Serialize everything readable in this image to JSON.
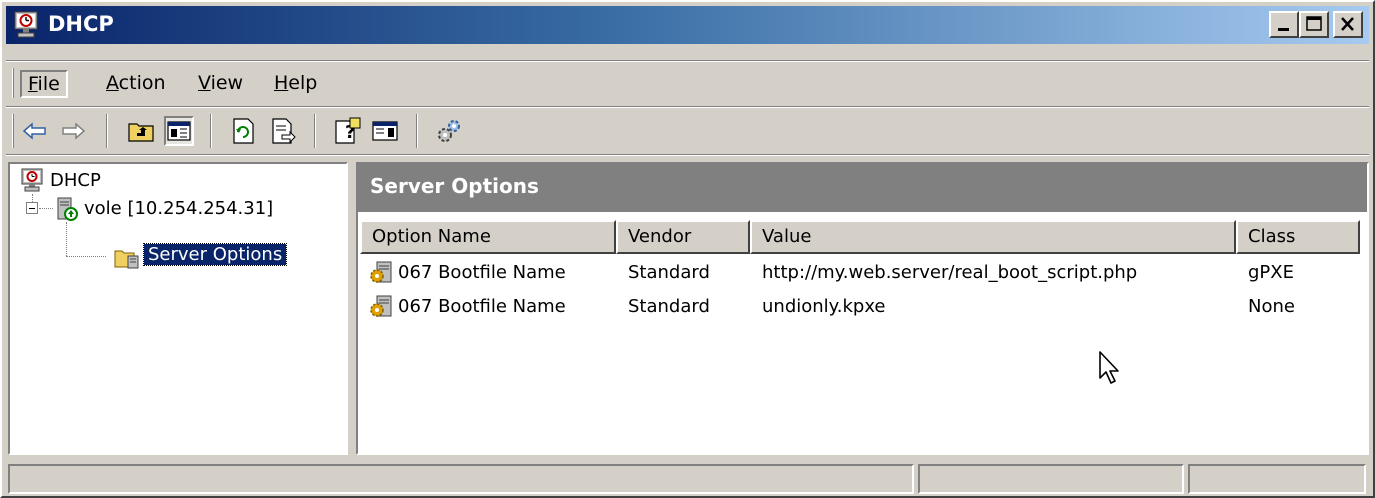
{
  "window": {
    "title": "DHCP",
    "app_icon": "dhcp-monitor-clock-icon",
    "controls": {
      "minimize": "minimize-icon",
      "maximize": "maximize-icon",
      "close": "close-icon"
    }
  },
  "menu": {
    "items": [
      {
        "accel": "F",
        "rest": "ile"
      },
      {
        "accel": "A",
        "rest": "ction"
      },
      {
        "accel": "V",
        "rest": "iew"
      },
      {
        "accel": "H",
        "rest": "elp"
      }
    ]
  },
  "toolbar": {
    "buttons": [
      "back-arrow-icon",
      "forward-arrow-icon",
      "up-one-level-icon",
      "show-hide-console-tree-icon",
      "refresh-icon",
      "export-list-icon",
      "help-icon",
      "show-hide-action-pane-icon",
      "dhcp-options-icon"
    ],
    "pressed": "show-hide-console-tree-icon"
  },
  "tree": {
    "root": "DHCP",
    "server": "vole [10.254.254.31]",
    "selected": "Server Options"
  },
  "pane": {
    "header": "Server Options",
    "columns": [
      "Option Name",
      "Vendor",
      "Value",
      "Class"
    ],
    "rows": [
      {
        "option_name": "067 Bootfile Name",
        "vendor": "Standard",
        "value": "http://my.web.server/real_boot_script.php",
        "class": "gPXE"
      },
      {
        "option_name": "067 Bootfile Name",
        "vendor": "Standard",
        "value": "undionly.kpxe",
        "class": "None"
      }
    ]
  },
  "colors": {
    "titlebar_start": "#0a246a",
    "titlebar_end": "#a6caf0",
    "face": "#d4d0c8",
    "pane_header": "#808080",
    "selection": "#0a246a"
  }
}
